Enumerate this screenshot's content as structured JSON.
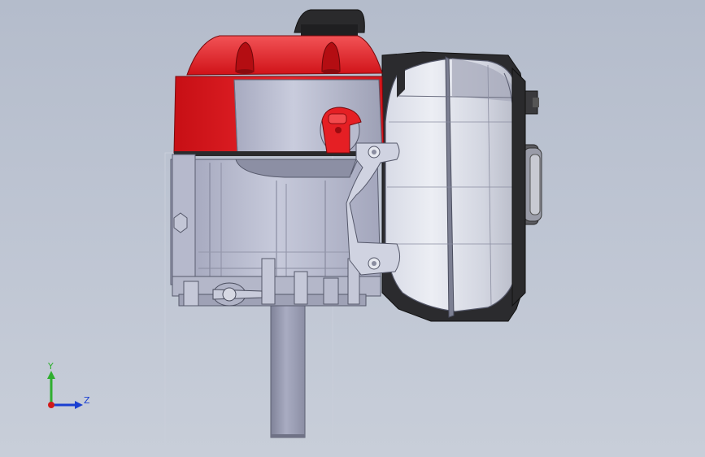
{
  "viewport": {
    "background_top": "#b4bccb",
    "background_bottom": "#c8ced9"
  },
  "model": {
    "description_colors": {
      "shroud_red": "#d8141b",
      "shroud_red_light": "#f0393c",
      "shroud_red_dark": "#a60c10",
      "metal_light": "#cfd2e2",
      "metal_mid": "#a9acc1",
      "metal_dark": "#7f8298",
      "black": "#2a2a2c"
    }
  },
  "triad": {
    "y_label": "Y",
    "z_label": "Z",
    "y_color": "#2fae2f",
    "z_color": "#1a3fd1",
    "x_color": "#d11a1a"
  }
}
